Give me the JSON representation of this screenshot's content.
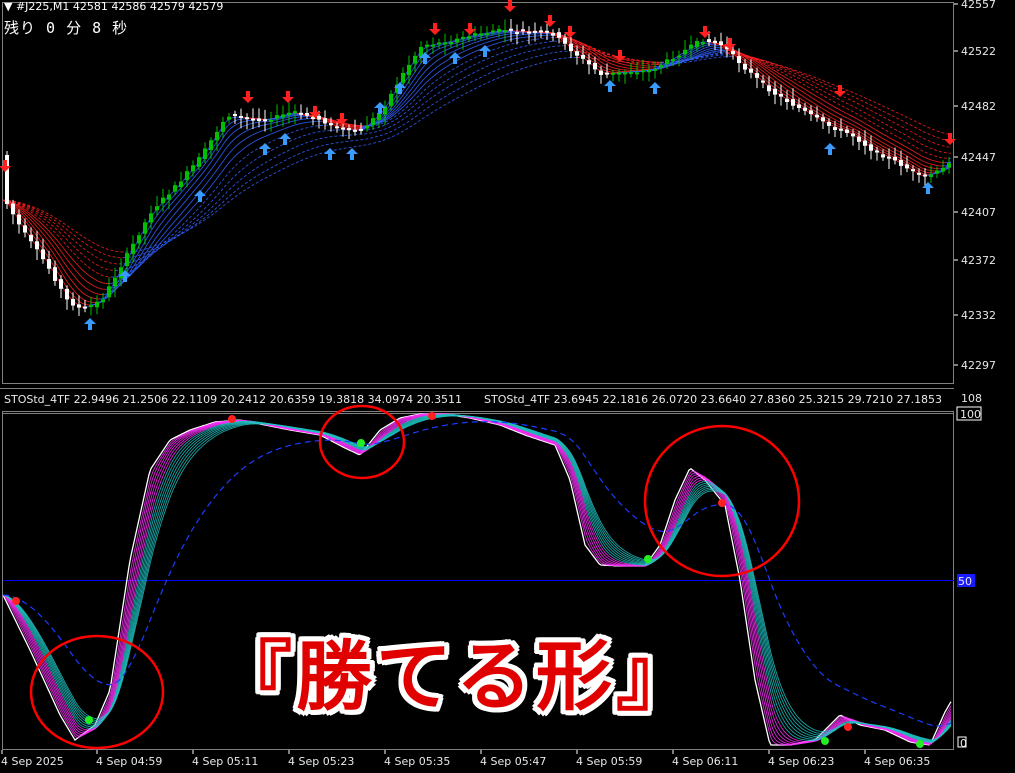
{
  "window": {
    "symbol_header": "▼ #J225,M1  42581 42586 42579 42579",
    "countdown": "残り 0 分 8 秒"
  },
  "price_axis": {
    "labels": [
      "42557",
      "42522",
      "42482",
      "42447",
      "42407",
      "42372",
      "42332",
      "42297"
    ]
  },
  "indicator": {
    "label_1": "STOStd_4TF 22.9496 21.2506 22.1109 20.2412 20.6359 19.3818 34.0974 20.3511",
    "label_2": "STOStd_4TF 23.6945 22.1816 26.0720 23.6640 27.8360 25.3215 29.7210 27.1853",
    "scale_top": "108",
    "scale_100": "100",
    "level_50": "50",
    "scale_0": "0"
  },
  "time_axis": {
    "labels": [
      "4 Sep 2025",
      "4 Sep 04:59",
      "4 Sep 05:11",
      "4 Sep 05:23",
      "4 Sep 05:35",
      "4 Sep 05:47",
      "4 Sep 05:59",
      "4 Sep 06:11",
      "4 Sep 06:23",
      "4 Sep 06:35"
    ]
  },
  "overlay_text": "『勝てる形』",
  "colors": {
    "background": "#000000",
    "bull_candle": "#00c000",
    "bear_candle": "#ffffff",
    "ribbon_up": "#3060ff",
    "ribbon_down": "#ff2020",
    "arrow_up": "#3a9bff",
    "arrow_down": "#ff2020",
    "stoch_main": "#ff30ff",
    "stoch_alt": "#20c0c0",
    "level_line": "#0000ff",
    "highlight_circle": "#ff0000",
    "headline": "#e00000"
  }
}
